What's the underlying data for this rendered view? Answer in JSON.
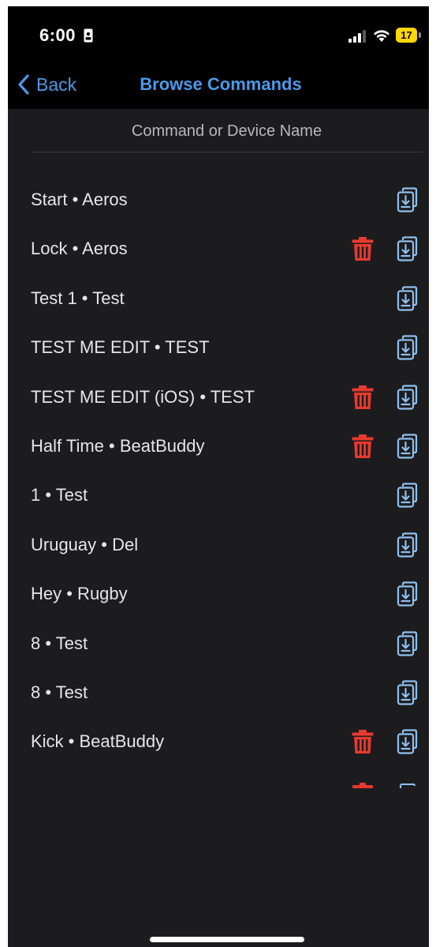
{
  "status_bar": {
    "time": "6:00",
    "battery": "17",
    "battery_color": "#ffd60a"
  },
  "nav": {
    "back_label": "Back",
    "title": "Browse Commands",
    "accent_color": "#4a9ae8"
  },
  "search": {
    "placeholder": "Command or Device Name",
    "value": ""
  },
  "commands": [
    {
      "label": "Start • Aeros",
      "deletable": false
    },
    {
      "label": "Lock • Aeros",
      "deletable": true
    },
    {
      "label": "Test 1 • Test",
      "deletable": false
    },
    {
      "label": "TEST ME EDIT • TEST",
      "deletable": false
    },
    {
      "label": "TEST ME EDIT (iOS) • TEST",
      "deletable": true
    },
    {
      "label": "Half Time • BeatBuddy",
      "deletable": true
    },
    {
      "label": "1 • Test",
      "deletable": false
    },
    {
      "label": "Uruguay • Del",
      "deletable": false
    },
    {
      "label": "Hey • Rugby",
      "deletable": false
    },
    {
      "label": "8 • Test",
      "deletable": false
    },
    {
      "label": "8 • Test",
      "deletable": false
    },
    {
      "label": "Kick • BeatBuddy",
      "deletable": true
    }
  ],
  "icons": {
    "trash": "trash-icon",
    "copy": "copy-download-icon",
    "trash_color": "#e8392f",
    "copy_color": "#8fc0ee"
  }
}
